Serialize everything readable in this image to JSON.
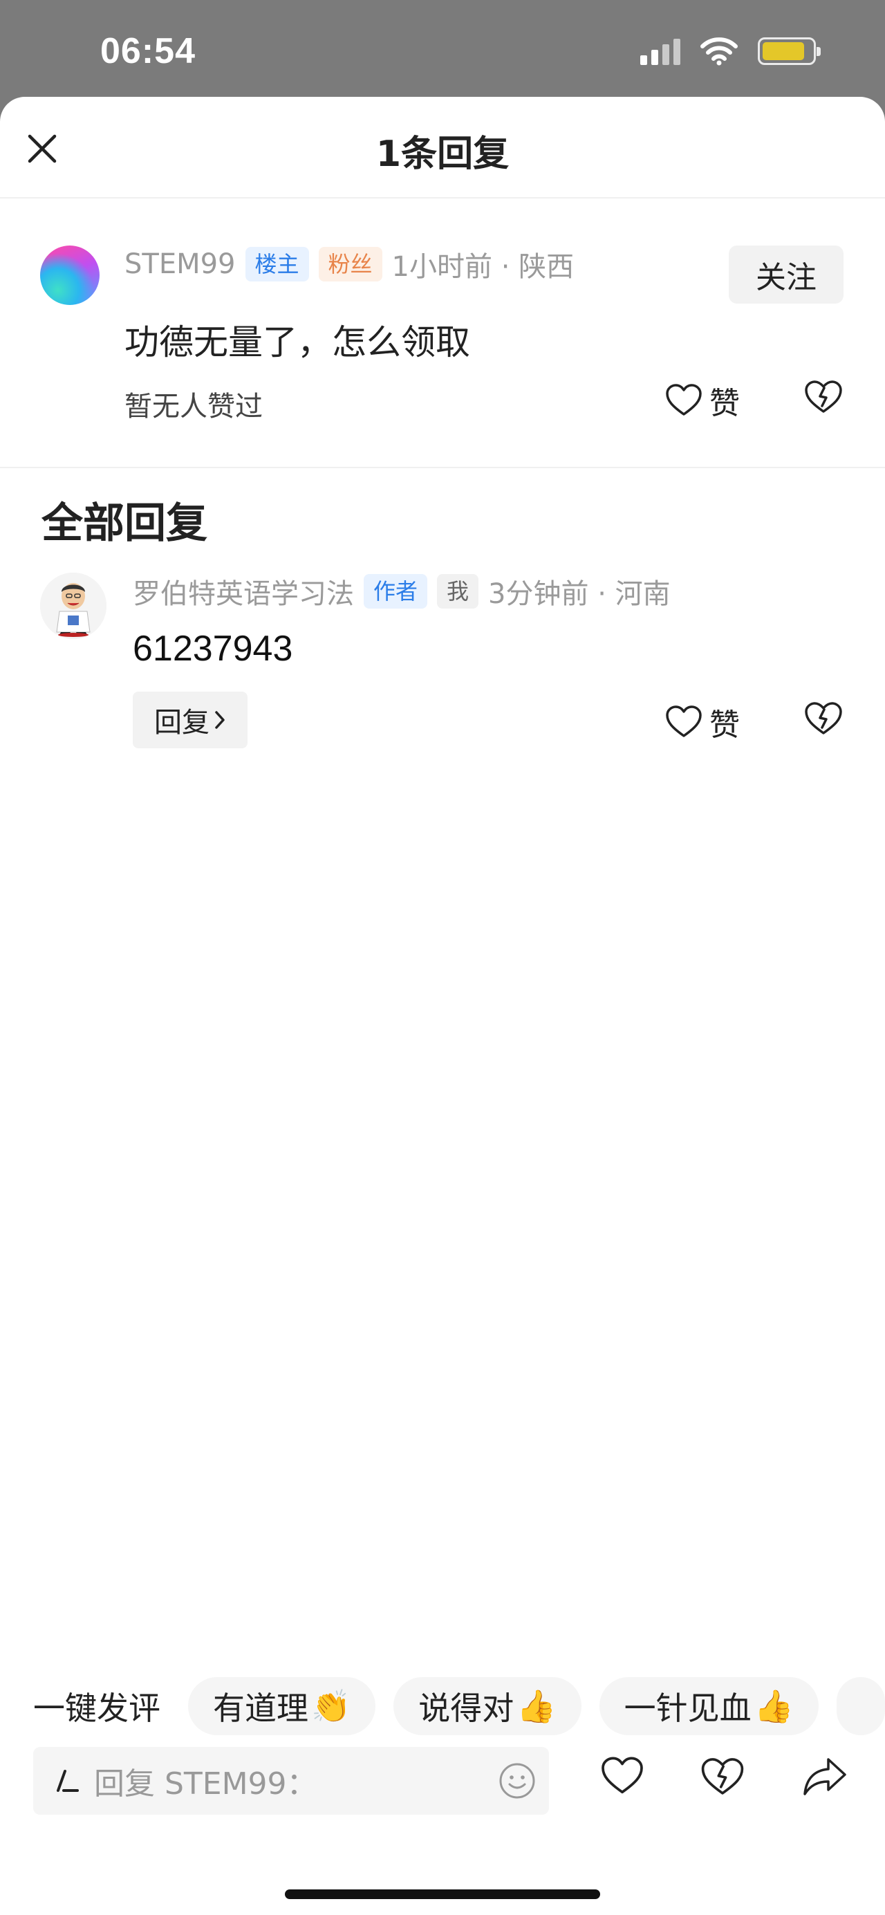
{
  "status": {
    "time": "06:54"
  },
  "header": {
    "title": "1条回复"
  },
  "main_comment": {
    "username": "STEM99",
    "tag_owner": "楼主",
    "tag_fan": "粉丝",
    "time_location": "1小时前 · 陕西",
    "follow_label": "关注",
    "text": "功德无量了，怎么领取",
    "likes_text": "暂无人赞过",
    "like_label": "赞"
  },
  "replies_section": {
    "title": "全部回复",
    "items": [
      {
        "username": "罗伯特英语学习法",
        "tag_author": "作者",
        "tag_me": "我",
        "time_location": "3分钟前 · 河南",
        "text": "61237943",
        "reply_label": "回复",
        "like_label": "赞"
      }
    ]
  },
  "quick_replies": {
    "label": "一键发评",
    "chips": [
      {
        "text": "有道理",
        "emoji": "👏"
      },
      {
        "text": "说得对",
        "emoji": "👍"
      },
      {
        "text": "一针见血",
        "emoji": "👍"
      }
    ]
  },
  "input": {
    "placeholder": "回复 STEM99："
  },
  "colors": {
    "accent_blue": "#2b7de8",
    "fan_orange": "#e8844a",
    "battery": "#f7d51b"
  }
}
